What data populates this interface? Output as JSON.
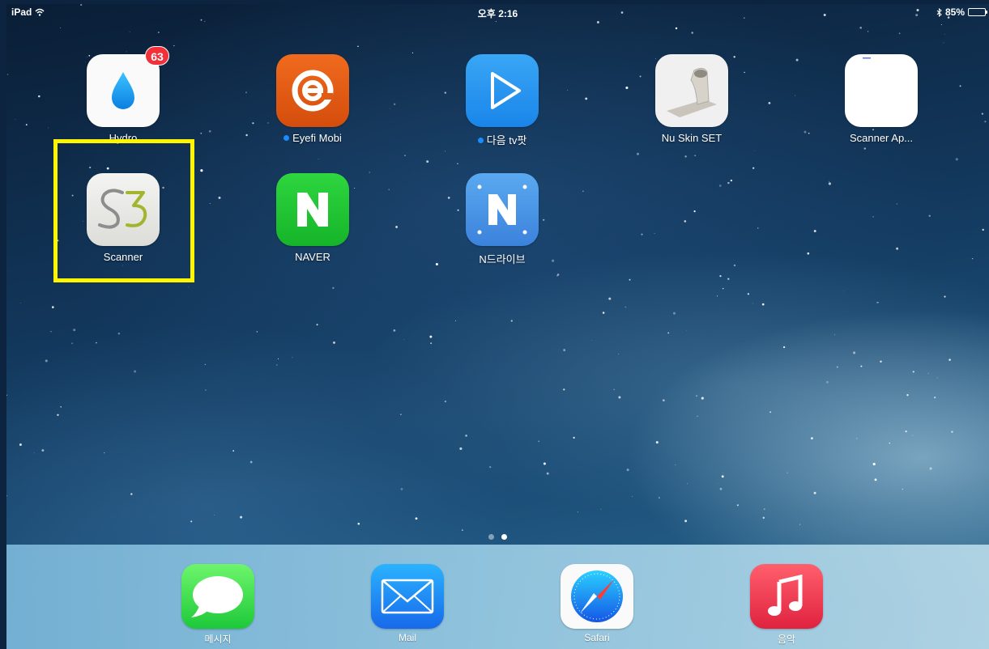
{
  "status_bar": {
    "device": "iPad",
    "time": "오후 2:16",
    "battery_text": "85%",
    "battery_level": 0.85
  },
  "apps": [
    {
      "label": "Hydro",
      "badge": "63"
    },
    {
      "label": "Eyefi Mobi",
      "new": true
    },
    {
      "label": "다음 tv팟",
      "new": true
    },
    {
      "label": "Nu Skin SET"
    },
    {
      "label": "Scanner Ap..."
    },
    {
      "label": "Scanner",
      "icon_text": "S3"
    },
    {
      "label": "NAVER",
      "icon_text": "N"
    },
    {
      "label": "N드라이브",
      "icon_text": "N"
    }
  ],
  "dock": [
    {
      "label": "메시지"
    },
    {
      "label": "Mail"
    },
    {
      "label": "Safari"
    },
    {
      "label": "음악"
    }
  ],
  "page_indicator": {
    "pages": 2,
    "current": 2
  },
  "colors": {
    "highlight": "#fff500",
    "badge": "#f1303a",
    "new_dot": "#1a8cff"
  }
}
